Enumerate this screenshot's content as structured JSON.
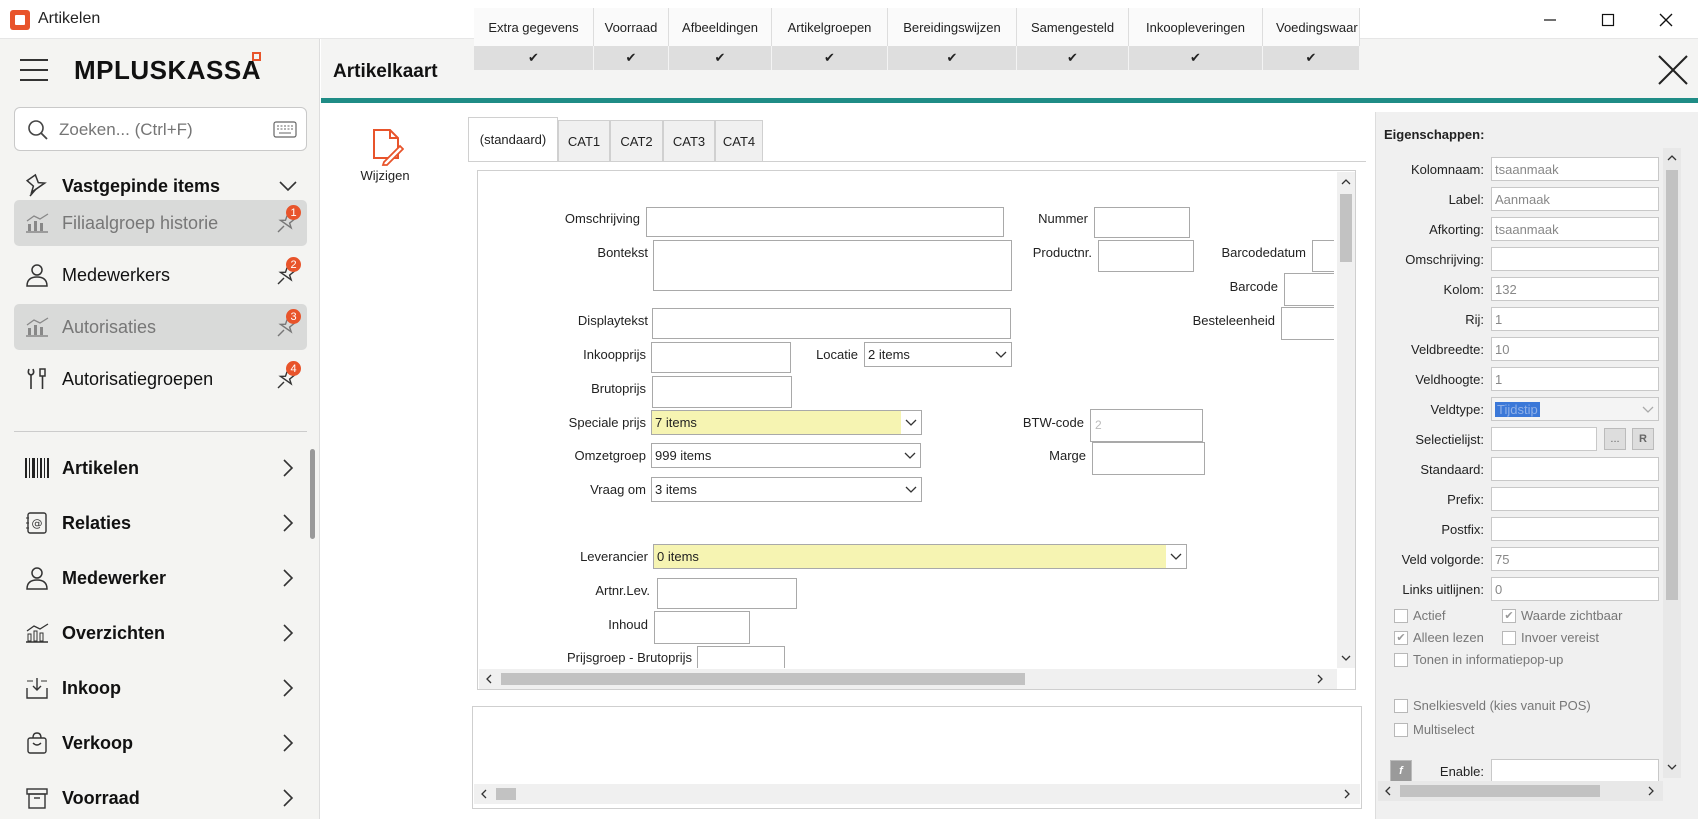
{
  "window": {
    "title": "Artikelen",
    "min": "—",
    "max": "☐",
    "close": "✕"
  },
  "sidebar": {
    "brand": "MPLUSKASSA",
    "search_placeholder": "Zoeken... (Ctrl+F)",
    "pinned_header": "Vastgepinde items",
    "pinned": [
      {
        "label": "Filiaalgroep historie",
        "badge": "1",
        "disabled": true
      },
      {
        "label": "Medewerkers",
        "badge": "2",
        "disabled": false
      },
      {
        "label": "Autorisaties",
        "badge": "3",
        "disabled": true
      },
      {
        "label": "Autorisatiegroepen",
        "badge": "4",
        "disabled": false
      }
    ],
    "menu": [
      {
        "label": "Artikelen",
        "icon": "barcode-icon"
      },
      {
        "label": "Relaties",
        "icon": "contacts-icon"
      },
      {
        "label": "Medewerker",
        "icon": "person-icon"
      },
      {
        "label": "Overzichten",
        "icon": "chart-icon"
      },
      {
        "label": "Inkoop",
        "icon": "inbox-icon"
      },
      {
        "label": "Verkoop",
        "icon": "bag-icon"
      },
      {
        "label": "Voorraad",
        "icon": "archive-icon"
      }
    ]
  },
  "main": {
    "title": "Artikelkaart",
    "toolbar": {
      "edit_label": "Wijzigen"
    },
    "tabs": [
      "(standaard)",
      "CAT1",
      "CAT2",
      "CAT3",
      "CAT4"
    ],
    "form": {
      "omschrijving": "Omschrijving",
      "nummer": "Nummer",
      "bontekst": "Bontekst",
      "productnr": "Productnr.",
      "barcodedatum": "Barcodedatum",
      "barcode": "Barcode",
      "displaytekst": "Displaytekst",
      "besteleenheid": "Besteleenheid",
      "inkoopprijs": "Inkoopprijs",
      "locatie": "Locatie",
      "locatie_value": "2 items",
      "brutoprijs": "Brutoprijs",
      "speciale_prijs": "Speciale prijs",
      "speciale_prijs_value": "7 items",
      "btw_code": "BTW-code",
      "btw_code_value": "2",
      "omzetgroep": "Omzetgroep",
      "omzetgroep_value": "999 items",
      "marge": "Marge",
      "vraag_om": "Vraag om",
      "vraag_om_value": "3 items",
      "leverancier": "Leverancier",
      "leverancier_value": "0 items",
      "artnr_lev": "Artnr.Lev.",
      "inhoud": "Inhoud",
      "prijsgroep": "Prijsgroep - Brutoprijs"
    },
    "bottom_tabs": [
      "Extra gegevens",
      "Voorraad",
      "Afbeeldingen",
      "Artikelgroepen",
      "Bereidingswijzen",
      "Samengesteld",
      "Inkoopleveringen",
      "Voedingswaar"
    ],
    "check": "✔"
  },
  "properties": {
    "title": "Eigenschappen:",
    "fields": [
      {
        "label": "Kolomnaam:",
        "value": "tsaanmaak"
      },
      {
        "label": "Label:",
        "value": "Aanmaak"
      },
      {
        "label": "Afkorting:",
        "value": "tsaanmaak"
      },
      {
        "label": "Omschrijving:",
        "value": ""
      },
      {
        "label": "Kolom:",
        "value": "132"
      },
      {
        "label": "Rij:",
        "value": "1"
      },
      {
        "label": "Veldbreedte:",
        "value": "10"
      },
      {
        "label": "Veldhoogte:",
        "value": "1"
      },
      {
        "label": "Veldtype:",
        "value": "Tijdstip"
      },
      {
        "label": "Selectielijst:",
        "value": ""
      },
      {
        "label": "Standaard:",
        "value": ""
      },
      {
        "label": "Prefix:",
        "value": ""
      },
      {
        "label": "Postfix:",
        "value": ""
      },
      {
        "label": "Veld volgorde:",
        "value": "75"
      },
      {
        "label": "Links uitlijnen:",
        "value": "0"
      }
    ],
    "select_btn": "...",
    "reset_btn": "R",
    "checks": {
      "actief": "Actief",
      "waarde_zichtbaar": "Waarde zichtbaar",
      "alleen_lezen": "Alleen lezen",
      "invoer_vereist": "Invoer vereist",
      "tonen_popup": "Tonen in informatiepop-up",
      "snelkiesveld": "Snelkiesveld (kies vanuit POS)",
      "multiselect": "Multiselect"
    },
    "enable_label": "Enable:",
    "f_btn": "f"
  }
}
